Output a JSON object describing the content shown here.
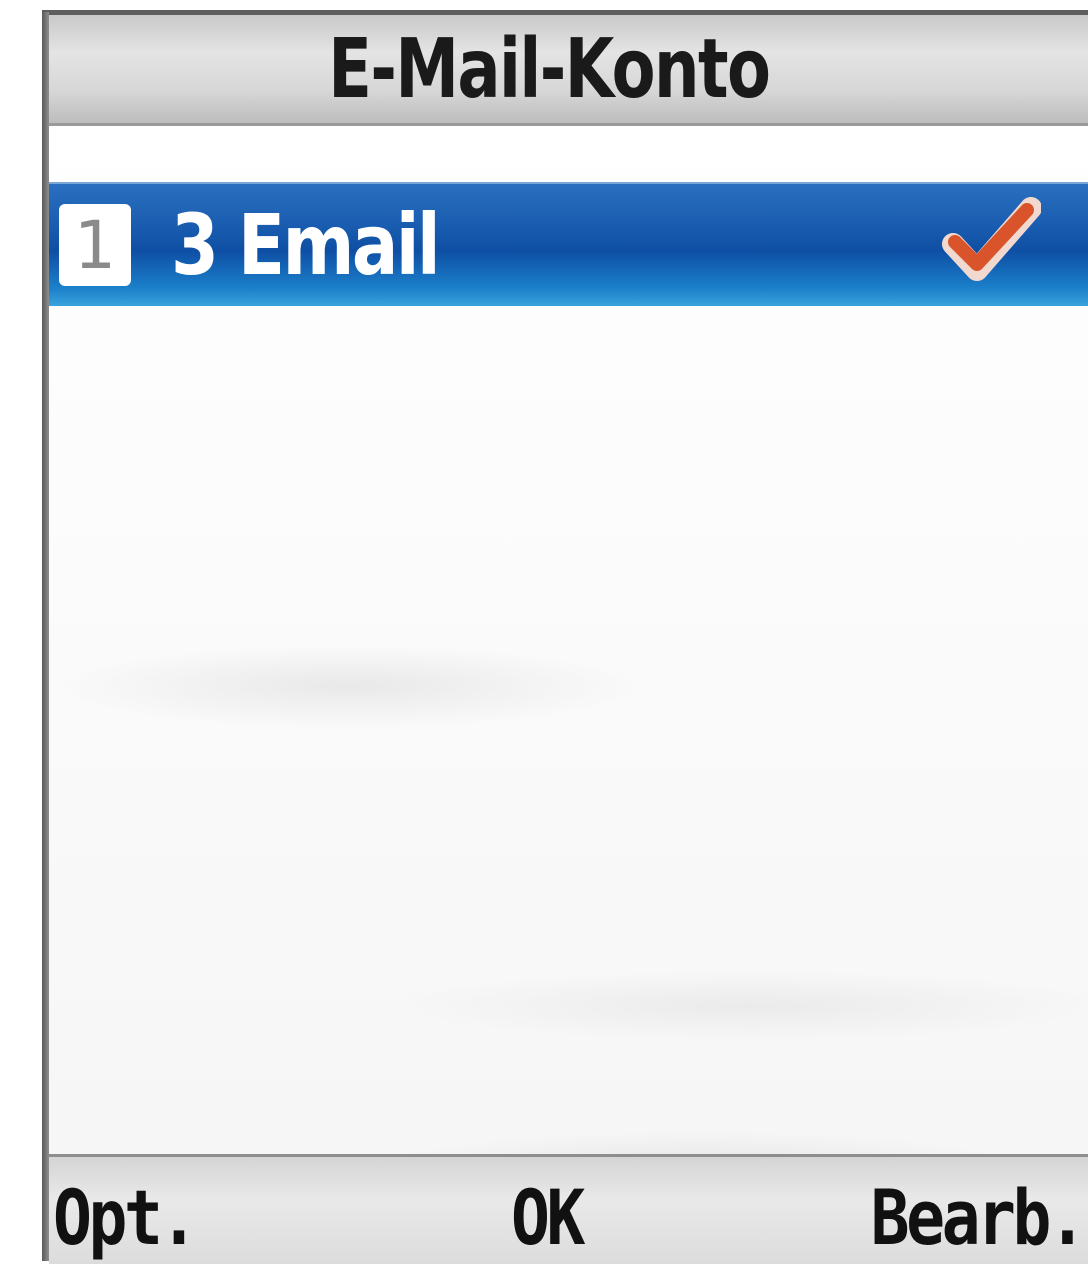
{
  "title": "E-Mail-Konto",
  "accounts": [
    {
      "number": "1",
      "label": "3 Email",
      "selected": true,
      "status_icon": "checkmark-icon"
    }
  ],
  "softkeys": {
    "left": "Opt.",
    "center": "OK",
    "right": "Bearb."
  },
  "colors": {
    "highlight": "#1c5fb2",
    "checkmark": "#d9532b",
    "title_bar": "#d7d7d7"
  }
}
